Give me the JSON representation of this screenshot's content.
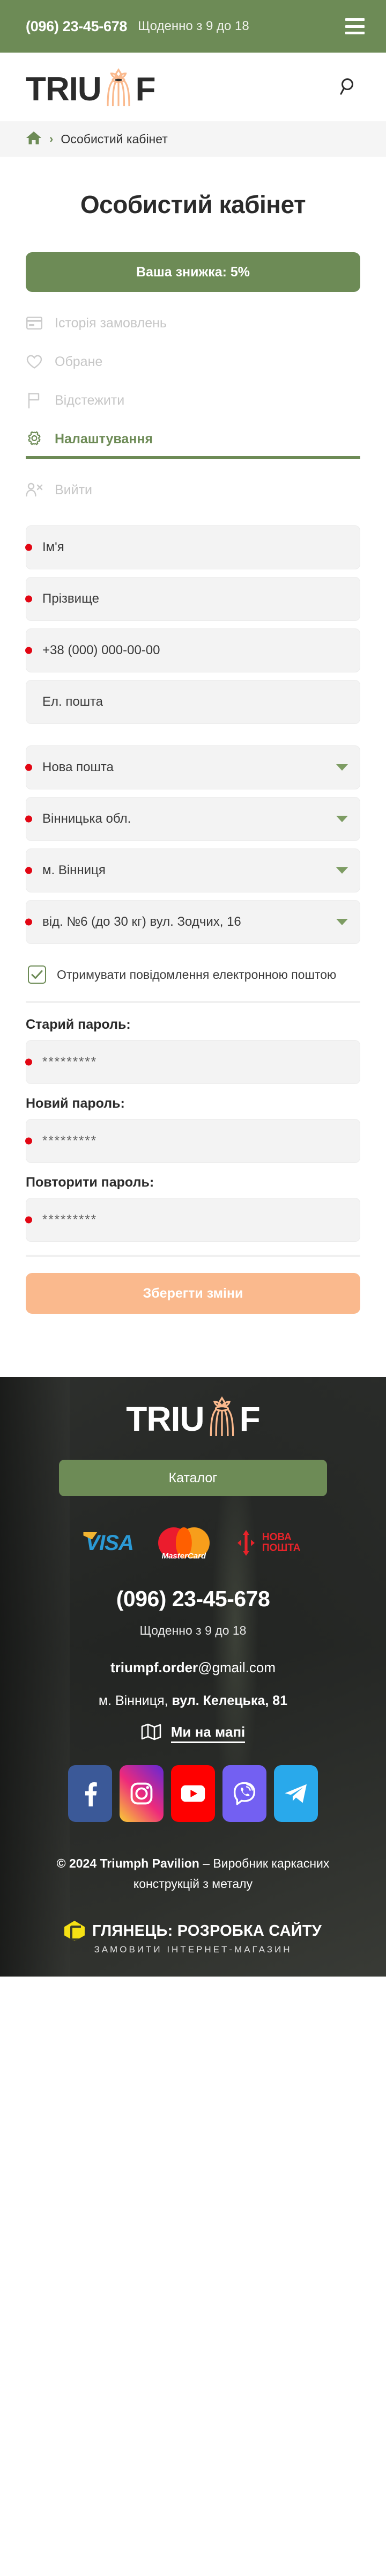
{
  "topbar": {
    "phone": "(096) 23-45-678",
    "hours": "Щоденно з 9 до 18",
    "menu_icon": "hamburger-menu-icon"
  },
  "header": {
    "logo_pre": "TRIU",
    "logo_post": "F",
    "logo_mark": "pavilion-crown-icon",
    "search_icon": "search-icon"
  },
  "breadcrumb": {
    "home_icon": "home-icon",
    "separator": "›",
    "current": "Особистий кабінет"
  },
  "page": {
    "title": "Особистий кабінет",
    "discount_banner": "Ваша знижка: 5%"
  },
  "account_menu": {
    "items": [
      {
        "label": "Історія замовлень",
        "icon": "credit-card-icon",
        "active": false
      },
      {
        "label": "Обране",
        "icon": "heart-icon",
        "active": false
      },
      {
        "label": "Відстежити",
        "icon": "flag-icon",
        "active": false
      },
      {
        "label": "Налаштування",
        "icon": "gear-icon",
        "active": true
      },
      {
        "label": "Вийти",
        "icon": "user-logout-icon",
        "active": false
      }
    ]
  },
  "form": {
    "first_name": {
      "placeholder": "Ім'я",
      "value": "",
      "required": true
    },
    "last_name": {
      "placeholder": "Прізвище",
      "value": "",
      "required": true
    },
    "phone": {
      "placeholder": "+38 (000) 000-00-00",
      "value": "",
      "required": true
    },
    "email": {
      "placeholder": "Ел. пошта",
      "value": "",
      "required": false
    },
    "delivery_service": {
      "value": "Нова пошта",
      "required": true
    },
    "region": {
      "value": "Вінницька обл.",
      "required": true
    },
    "city": {
      "value": "м. Вінниця",
      "required": true
    },
    "branch": {
      "value": "від. №6 (до 30 кг) вул. Зодчих, 16",
      "required": true
    },
    "newsletter": {
      "label": "Отримувати повідомлення електронною поштою",
      "checked": true,
      "check_icon": "checkmark-icon"
    },
    "old_password": {
      "label": "Старий пароль:",
      "value": "*********",
      "required": true
    },
    "new_password": {
      "label": "Новий пароль:",
      "value": "*********",
      "required": true
    },
    "repeat_password": {
      "label": "Повторити пароль:",
      "value": "*********",
      "required": true
    },
    "save_button": "Зберегти зміни"
  },
  "footer": {
    "logo_pre": "TRIU",
    "logo_post": "F",
    "catalog_button": "Каталог",
    "payments": [
      {
        "name": "VISA",
        "icon": "visa-logo"
      },
      {
        "name": "MasterCard",
        "icon": "mastercard-logo"
      },
      {
        "name": "НОВА ПОШТА",
        "icon": "nova-poshta-logo"
      }
    ],
    "payment_mastercard_label": "MasterCard",
    "payment_visa_label": "VISA",
    "payment_np_line1": "НОВА",
    "payment_np_line2": "ПОШТА",
    "phone": "(096) 23-45-678",
    "hours": "Щоденно з 9 до 18",
    "email_user": "triumpf.order",
    "email_domain": "@gmail.com",
    "address_city": "м. Вінниця, ",
    "address_street": "вул. Келецька, 81",
    "map_link": "Ми на мапі",
    "map_icon": "map-icon",
    "socials": [
      {
        "name": "Facebook",
        "icon": "facebook-icon"
      },
      {
        "name": "Instagram",
        "icon": "instagram-icon"
      },
      {
        "name": "YouTube",
        "icon": "youtube-icon"
      },
      {
        "name": "Viber",
        "icon": "viber-icon"
      },
      {
        "name": "Telegram",
        "icon": "telegram-icon"
      }
    ],
    "copyright_bold": "© 2024 Triumph Pavilion",
    "copyright_rest": " – Виробник каркасних конструкцій з металу",
    "developer_title": "ГЛЯНЕЦЬ: РОЗРОБКА САЙТУ",
    "developer_sub": "ЗАМОВИТИ ІНТЕРНЕТ-МАГАЗИН"
  },
  "colors": {
    "brand_green": "#6d8b56",
    "brand_peach": "#fab98d",
    "required_red": "#e20613",
    "footer_dark": "#3a3c3a"
  }
}
